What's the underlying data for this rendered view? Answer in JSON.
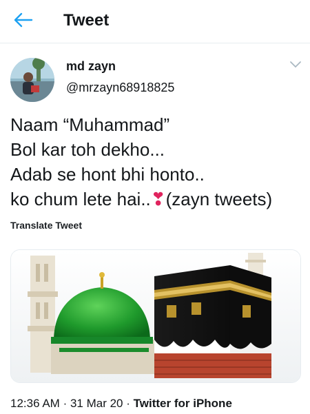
{
  "header": {
    "title": "Tweet",
    "back_icon": "arrow-left-icon",
    "accent": "#1da1f2"
  },
  "author": {
    "name": "md zayn",
    "handle": "@mrzayn68918825"
  },
  "tweet": {
    "lines": [
      "Naam “Muhammad”",
      "Bol kar toh dekho...",
      "Adab se hont bhi honto..",
      "ko chum lete hai.."
    ],
    "emoji": "❣",
    "suffix": "(zayn tweets)",
    "translate_label": "Translate Tweet"
  },
  "media": {
    "icons": [
      "green-dome-icon",
      "kaaba-icon",
      "minaret-icon"
    ]
  },
  "meta": {
    "time": "12:36 AM",
    "sep": "·",
    "date": "31 Mar 20",
    "source": "Twitter for iPhone"
  }
}
